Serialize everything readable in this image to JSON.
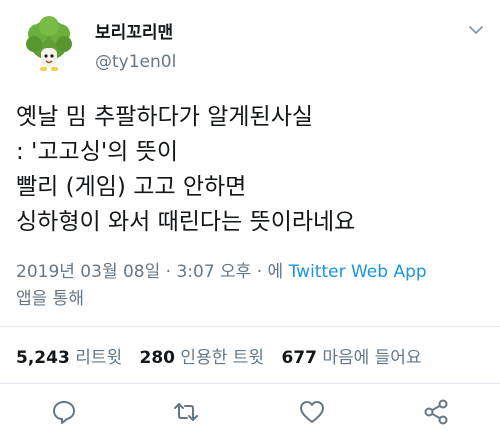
{
  "author": {
    "name": "보리꼬리맨",
    "handle": "@ty1en0l",
    "avatar_icon": "broccoli-avatar-icon"
  },
  "menu_icon": "chevron-down-icon",
  "tweet": {
    "lines": [
      "옛날 밈 추팔하다가 알게된사실",
      ": '고고싱'의 뜻이",
      "빨리 (게임) 고고 안하면",
      "싱하형이 와서 때린다는 뜻이라네요"
    ]
  },
  "meta": {
    "timestamp": "2019년 03월 08일 · 3:07 오후 · 에 ",
    "source": "Twitter Web App",
    "source_suffix": "앱을 통해"
  },
  "stats": {
    "retweets_count": "5,243",
    "retweets_label": "리트윗",
    "quotes_count": "280",
    "quotes_label": "인용한 트윗",
    "likes_count": "677",
    "likes_label": "마음에 들어요"
  },
  "actions": {
    "reply_icon": "reply-icon",
    "retweet_icon": "retweet-icon",
    "like_icon": "heart-icon",
    "share_icon": "share-icon"
  },
  "colors": {
    "text": "#14171a",
    "secondary": "#657786",
    "link": "#1b95e0",
    "divider": "#e1e8ed"
  }
}
